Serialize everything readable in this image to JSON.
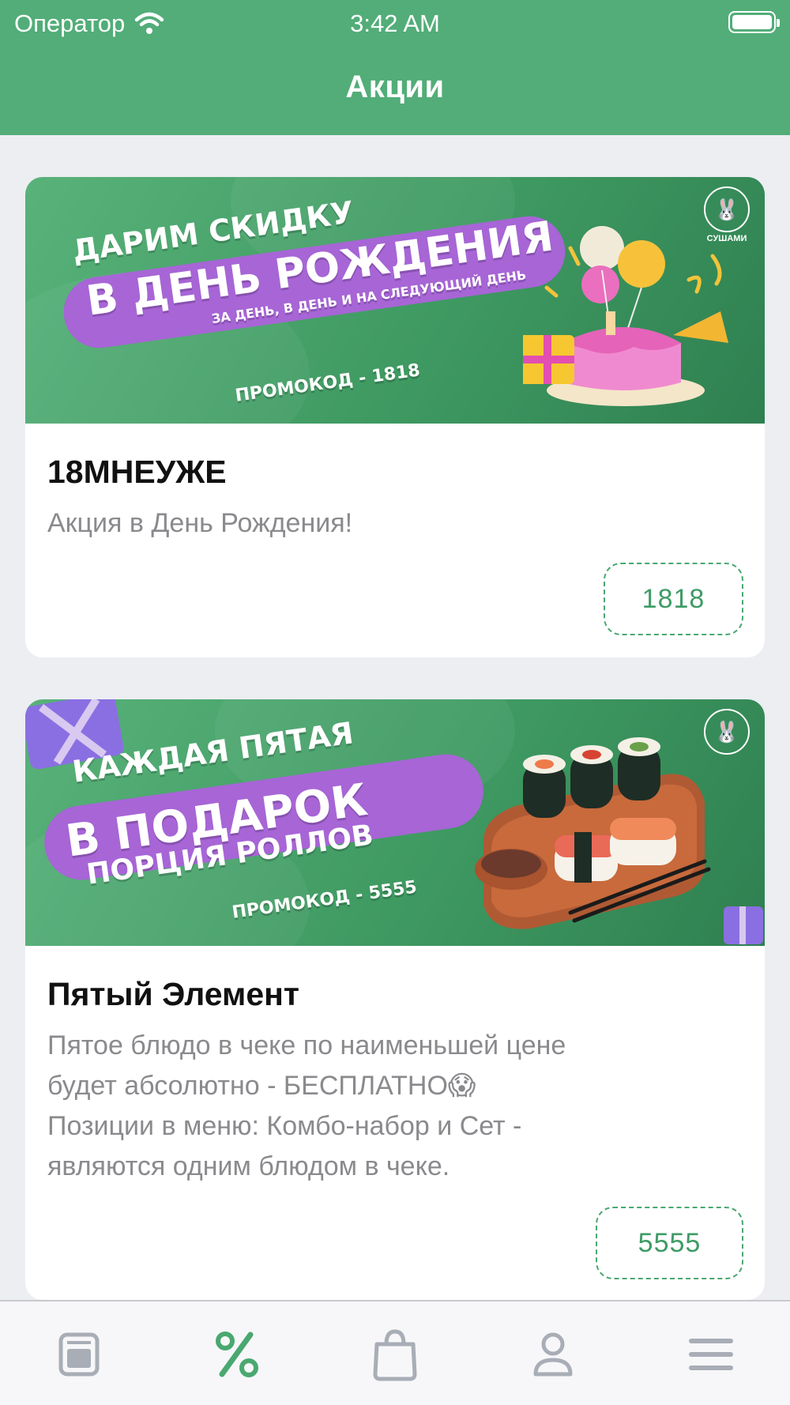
{
  "status_bar": {
    "carrier": "Оператор",
    "time": "3:42 AM"
  },
  "header": {
    "title": "Акции"
  },
  "promotions": [
    {
      "banner": {
        "line1": "ДАРИМ СКИДКУ",
        "line2": "В ДЕНЬ РОЖДЕНИЯ",
        "line3": "ЗА ДЕНЬ, В ДЕНЬ И НА СЛЕДУЮЩИЙ ДЕНЬ",
        "promo": "ПРОМОКОД - 1818",
        "logo": "СУШАМИ"
      },
      "title": "18МНЕУЖЕ",
      "description": "Акция в День Рождения!",
      "code": "1818"
    },
    {
      "banner": {
        "line1": "КАЖДАЯ ПЯТАЯ",
        "line2": "В ПОДАРОК",
        "line3": "ПОРЦИЯ РОЛЛОВ",
        "promo": "ПРОМОКОД - 5555",
        "logo": "СУШАМИ"
      },
      "title": "Пятый Элемент",
      "description_lines": [
        "Пятое блюдо в чеке по наименьшей цене",
        "будет абсолютно - БЕСПЛАТНО😱",
        "Позиции в меню: Комбо-набор и Сет -",
        "являются одним блюдом в чеке."
      ],
      "code": "5555"
    }
  ],
  "tabbar": {
    "items": [
      {
        "icon": "menu-card-icon",
        "active": false
      },
      {
        "icon": "percent-icon",
        "active": true
      },
      {
        "icon": "bag-icon",
        "active": false
      },
      {
        "icon": "profile-icon",
        "active": false
      },
      {
        "icon": "hamburger-menu-icon",
        "active": false
      }
    ],
    "active_color": "#4aa870",
    "inactive_color": "#a8adb6"
  },
  "colors": {
    "accent": "#52ad78",
    "pill": "#a765d6"
  }
}
